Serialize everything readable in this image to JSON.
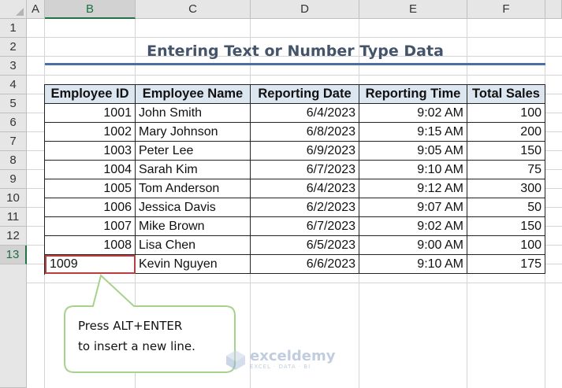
{
  "columns": [
    "A",
    "B",
    "C",
    "D",
    "E",
    "F"
  ],
  "rows": [
    "1",
    "2",
    "3",
    "4",
    "5",
    "6",
    "7",
    "8",
    "9",
    "10",
    "11",
    "12",
    "13"
  ],
  "title": "Entering Text or Number Type Data",
  "headers": [
    "Employee ID",
    "Employee Name",
    "Reporting Date",
    "Reporting Time",
    "Total Sales"
  ],
  "records": [
    {
      "id": "1001",
      "name": "John Smith",
      "date": "6/4/2023",
      "time": "9:02 AM",
      "sales": "100"
    },
    {
      "id": "1002",
      "name": "Mary Johnson",
      "date": "6/8/2023",
      "time": "9:15 AM",
      "sales": "200"
    },
    {
      "id": "1003",
      "name": "Peter Lee",
      "date": "6/9/2023",
      "time": "9:05 AM",
      "sales": "150"
    },
    {
      "id": "1004",
      "name": "Sarah Kim",
      "date": "6/7/2023",
      "time": "9:10 AM",
      "sales": "75"
    },
    {
      "id": "1005",
      "name": "Tom Anderson",
      "date": "6/4/2023",
      "time": "9:12 AM",
      "sales": "300"
    },
    {
      "id": "1006",
      "name": "Jessica Davis",
      "date": "6/2/2023",
      "time": "9:07 AM",
      "sales": "50"
    },
    {
      "id": "1007",
      "name": "Mike Brown",
      "date": "6/7/2023",
      "time": "9:02 AM",
      "sales": "150"
    },
    {
      "id": "1008",
      "name": "Lisa Chen",
      "date": "6/5/2023",
      "time": "9:00 AM",
      "sales": "100"
    },
    {
      "id": "1009",
      "name": "Kevin Nguyen",
      "date": "6/6/2023",
      "time": "9:10 AM",
      "sales": "175"
    }
  ],
  "active_cell": "B13",
  "callout": {
    "line1": "Press ALT+ENTER",
    "line2": "to insert a new line."
  },
  "watermark": {
    "name": "exceldemy",
    "tagline": "EXCEL · DATA · BI",
    "icon": "exceldemy-logo-icon"
  },
  "colors": {
    "title": "#44546a",
    "header_fill": "#dce6f1",
    "active_border": "#b63f3f",
    "callout_border": "#a9d18e",
    "selection_green": "#217346"
  }
}
